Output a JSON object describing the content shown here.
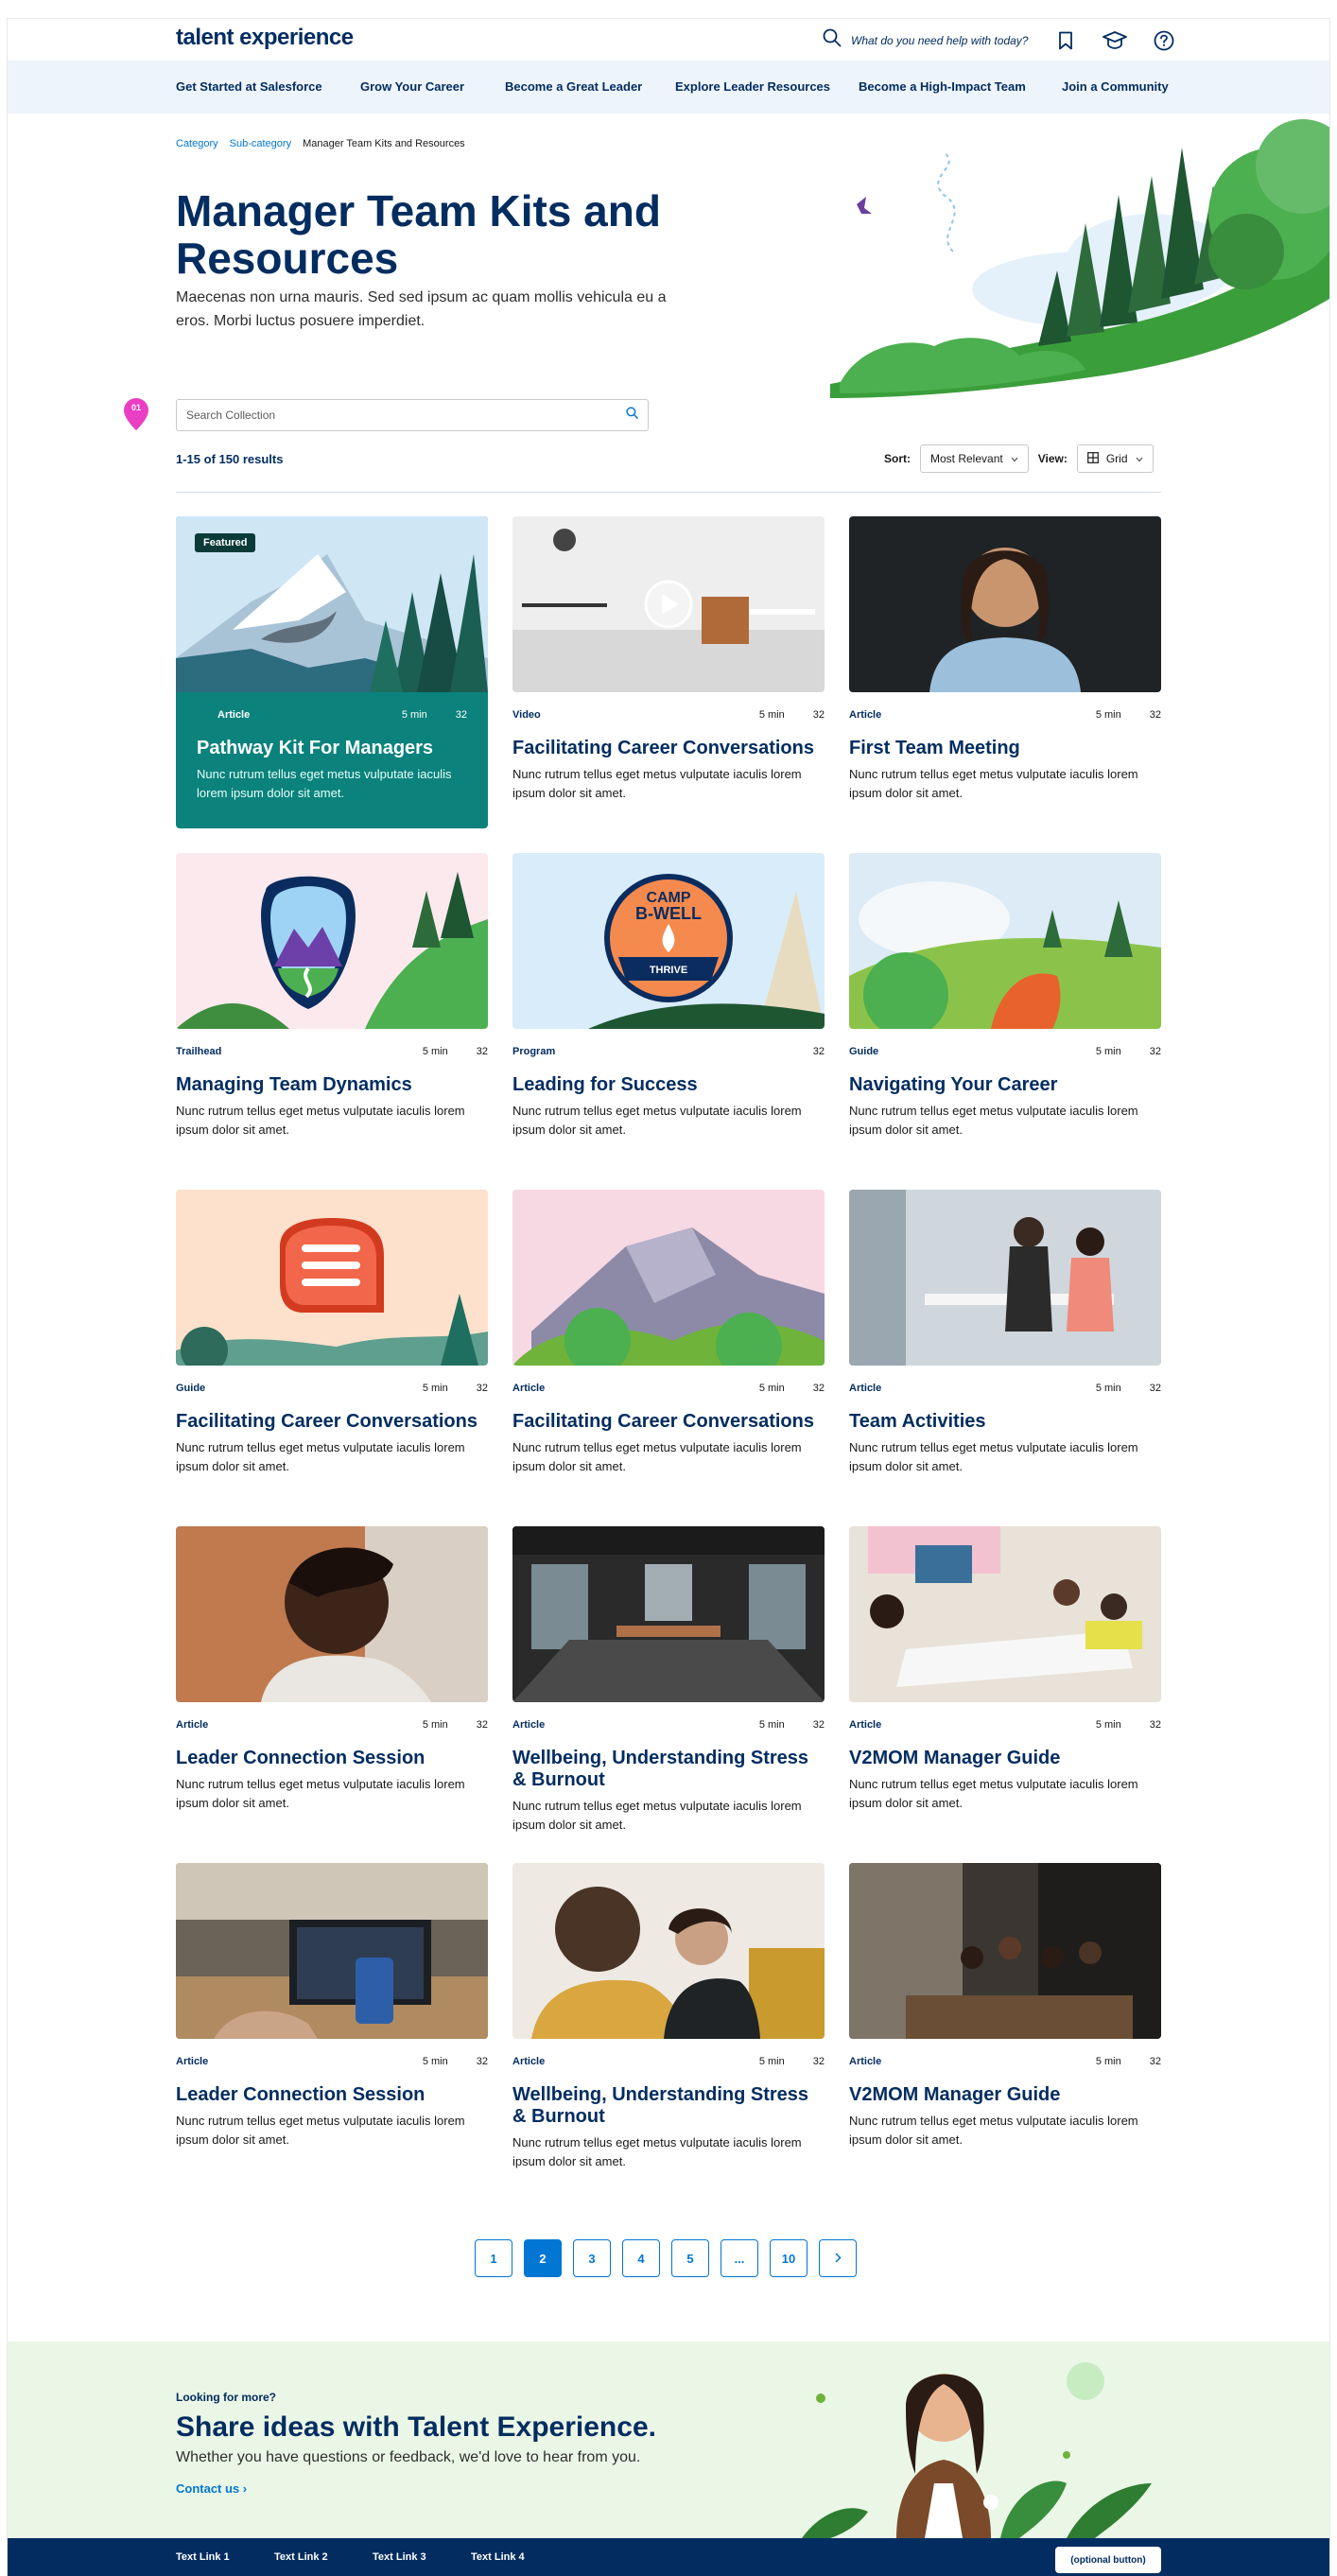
{
  "header": {
    "logo": "talent experience",
    "search_placeholder": "What do you need help with today?"
  },
  "nav": {
    "items": [
      "Get Started at Salesforce",
      "Grow Your Career",
      "Become a Great Leader",
      "Explore Leader Resources",
      "Become a High-Impact Team",
      "Join a Community"
    ]
  },
  "breadcrumb": {
    "category": "Category",
    "subcategory": "Sub-category",
    "current": "Manager Team Kits and Resources"
  },
  "hero": {
    "title": "Manager Team Kits and Resources",
    "description": "Maecenas non urna mauris. Sed sed ipsum ac quam mollis vehicula eu a eros. Morbi luctus posuere imperdiet."
  },
  "pin_label": "01",
  "collection": {
    "search_placeholder": "Search Collection",
    "results_text": "1-15 of 150 results",
    "sort_label": "Sort:",
    "sort_value": "Most Relevant",
    "view_label": "View:",
    "view_value": "Grid"
  },
  "featured_badge": "Featured",
  "cards": [
    {
      "type": "Article",
      "time": "5 min",
      "count": "32",
      "title": "Pathway Kit For Managers",
      "desc": "Nunc rutrum tellus eget metus vulputate iaculis lorem ipsum dolor sit amet."
    },
    {
      "type": "Video",
      "time": "5 min",
      "count": "32",
      "title": "Facilitating Career Conversations",
      "desc": "Nunc rutrum tellus eget metus vulputate iaculis lorem ipsum dolor sit amet."
    },
    {
      "type": "Article",
      "time": "5 min",
      "count": "32",
      "title": "First Team Meeting",
      "desc": "Nunc rutrum tellus eget metus vulputate iaculis lorem ipsum dolor sit amet."
    },
    {
      "type": "Trailhead",
      "time": "5 min",
      "count": "32",
      "title": "Managing Team Dynamics",
      "desc": "Nunc rutrum tellus eget metus vulputate iaculis lorem ipsum dolor sit amet."
    },
    {
      "type": "Program",
      "time": "",
      "count": "32",
      "title": "Leading for Success",
      "desc": "Nunc rutrum tellus eget metus vulputate iaculis lorem ipsum dolor sit amet."
    },
    {
      "type": "Guide",
      "time": "5 min",
      "count": "32",
      "title": "Navigating Your Career",
      "desc": "Nunc rutrum tellus eget metus vulputate iaculis lorem ipsum dolor sit amet."
    },
    {
      "type": "Guide",
      "time": "5 min",
      "count": "32",
      "title": "Facilitating Career Conversations",
      "desc": "Nunc rutrum tellus eget metus vulputate iaculis lorem ipsum dolor sit amet."
    },
    {
      "type": "Article",
      "time": "5 min",
      "count": "32",
      "title": "Facilitating Career Conversations",
      "desc": "Nunc rutrum tellus eget metus vulputate iaculis lorem ipsum dolor sit amet."
    },
    {
      "type": "Article",
      "time": "5 min",
      "count": "32",
      "title": "Team Activities",
      "desc": "Nunc rutrum tellus eget metus vulputate iaculis lorem ipsum dolor sit amet."
    },
    {
      "type": "Article",
      "time": "5 min",
      "count": "32",
      "title": "Leader Connection Session",
      "desc": "Nunc rutrum tellus eget metus vulputate iaculis lorem ipsum dolor sit amet."
    },
    {
      "type": "Article",
      "time": "5 min",
      "count": "32",
      "title": "Wellbeing, Understanding Stress & Burnout",
      "desc": "Nunc rutrum tellus eget metus vulputate iaculis lorem ipsum dolor sit amet."
    },
    {
      "type": "Article",
      "time": "5 min",
      "count": "32",
      "title": "V2MOM Manager Guide",
      "desc": "Nunc rutrum tellus eget metus vulputate iaculis lorem ipsum dolor sit amet."
    },
    {
      "type": "Article",
      "time": "5 min",
      "count": "32",
      "title": "Leader Connection Session",
      "desc": "Nunc rutrum tellus eget metus vulputate iaculis lorem ipsum dolor sit amet."
    },
    {
      "type": "Article",
      "time": "5 min",
      "count": "32",
      "title": "Wellbeing, Understanding Stress & Burnout",
      "desc": "Nunc rutrum tellus eget metus vulputate iaculis lorem ipsum dolor sit amet."
    },
    {
      "type": "Article",
      "time": "5 min",
      "count": "32",
      "title": "V2MOM Manager Guide",
      "desc": "Nunc rutrum tellus eget metus vulputate iaculis lorem ipsum dolor sit amet."
    }
  ],
  "camp_badge": {
    "line1": "CAMP",
    "line2": "B-WELL",
    "line3": "THRIVE"
  },
  "pagination": {
    "pages": [
      "1",
      "2",
      "3",
      "4",
      "5",
      "...",
      "10"
    ],
    "active": "2"
  },
  "cta": {
    "eyebrow": "Looking for more?",
    "title": "Share ideas with Talent Experience.",
    "subtitle": "Whether you have questions or feedback, we'd love to hear from you.",
    "link": "Contact us"
  },
  "footer": {
    "links": [
      "Text Link 1",
      "Text Link 2",
      "Text Link 3",
      "Text Link 4"
    ],
    "button": "(optional button)"
  },
  "colors": {
    "navy": "#032d60",
    "blue": "#0176d3",
    "teal": "#0b827c",
    "nav_bg": "#eef4fc",
    "cta_bg": "#ebf7e6"
  }
}
